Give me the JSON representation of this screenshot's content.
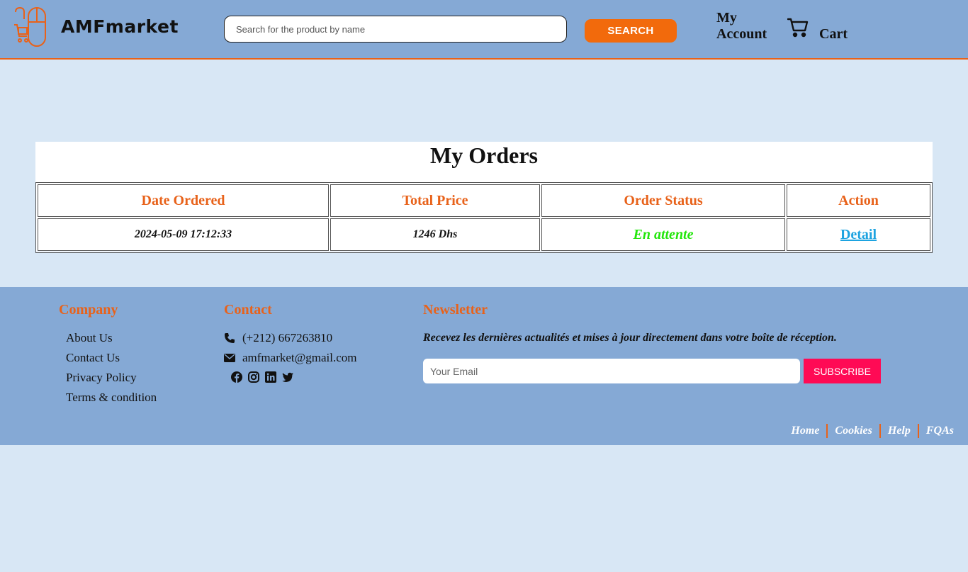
{
  "header": {
    "brand": "AMFmarket",
    "search_placeholder": "Search for the product by name",
    "search_button": "SEARCH",
    "account_line1": "My",
    "account_line2": "Account",
    "cart": "Cart"
  },
  "orders": {
    "title": "My Orders",
    "columns": [
      "Date Ordered",
      "Total Price",
      "Order Status",
      "Action"
    ],
    "rows": [
      {
        "date": "2024-05-09 17:12:33",
        "total": "1246 Dhs",
        "status": "En attente",
        "action": "Detail"
      }
    ]
  },
  "footer": {
    "company": {
      "heading": "Company",
      "links": [
        "About Us",
        "Contact Us",
        "Privacy Policy",
        "Terms & condition"
      ]
    },
    "contact": {
      "heading": "Contact",
      "phone": "(+212) 667263810",
      "email": "amfmarket@gmail.com",
      "socials": [
        "facebook-icon",
        "instagram-icon",
        "linkedin-icon",
        "twitter-icon"
      ]
    },
    "newsletter": {
      "heading": "Newsletter",
      "text": "Recevez les dernières actualités et mises à jour directement dans votre boîte de réception.",
      "email_placeholder": "Your Email",
      "subscribe": "SUBSCRIBE"
    },
    "bottom_links": [
      "Home",
      "Cookies",
      "Help",
      "FQAs"
    ]
  },
  "colors": {
    "header_bg": "#85a9d5",
    "page_bg": "#d8e7f5",
    "accent": "#e8621a",
    "status_pending": "#22e60a",
    "link": "#1da3e0",
    "subscribe": "#ff0a55"
  }
}
